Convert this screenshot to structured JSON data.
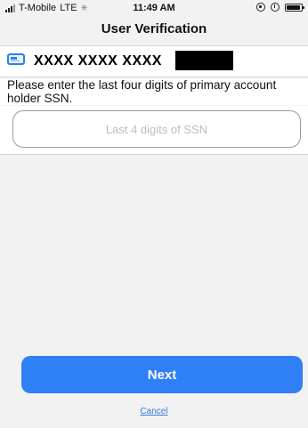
{
  "status_bar": {
    "carrier": "T-Mobile",
    "network": "LTE",
    "time": "11:49 AM",
    "activity_icon": "loading-spinner-icon",
    "right_icons": [
      "rotation-lock-icon",
      "alarm-icon",
      "battery-icon"
    ]
  },
  "header": {
    "title": "User Verification"
  },
  "account": {
    "icon": "credit-card-icon",
    "masked_number": "XXXX XXXX XXXX"
  },
  "form": {
    "instruction": "Please enter the last four digits of primary account holder SSN.",
    "ssn_placeholder": "Last 4 digits of SSN",
    "ssn_value": ""
  },
  "actions": {
    "next_label": "Next",
    "cancel_label": "Cancel"
  },
  "colors": {
    "accent": "#2f80f7",
    "link": "#3a78d8",
    "background": "#f2f2f2"
  }
}
